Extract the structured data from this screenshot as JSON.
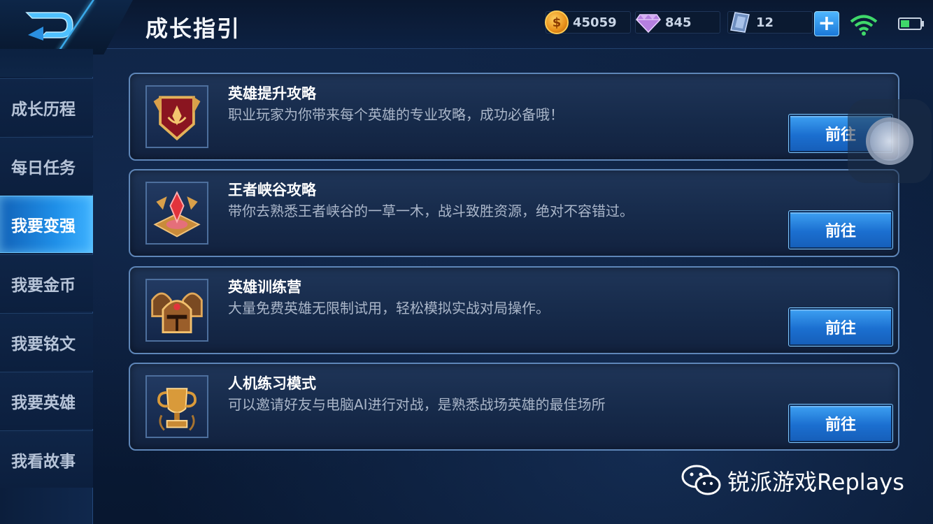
{
  "header": {
    "title": "成长指引",
    "currencies": {
      "gold": "45059",
      "gems": "845",
      "tickets": "12"
    },
    "plus_label": "+"
  },
  "sidebar": {
    "items": [
      {
        "label": "成长历程"
      },
      {
        "label": "每日任务"
      },
      {
        "label": "我要变强"
      },
      {
        "label": "我要金币"
      },
      {
        "label": "我要铭文"
      },
      {
        "label": "我要英雄"
      },
      {
        "label": "我看故事"
      }
    ],
    "active_index": 2
  },
  "cards": [
    {
      "title": "英雄提升攻略",
      "desc": "职业玩家为你带来每个英雄的专业攻略，成功必备哦！",
      "button": "前往",
      "icon": "crest-icon"
    },
    {
      "title": "王者峡谷攻略",
      "desc": "带你去熟悉王者峡谷的一草一木，战斗致胜资源，绝对不容错过。",
      "button": "前往",
      "icon": "crystal-icon"
    },
    {
      "title": "英雄训练营",
      "desc": "大量免费英雄无限制试用，轻松模拟实战对局操作。",
      "button": "前往",
      "icon": "helmet-icon"
    },
    {
      "title": "人机练习模式",
      "desc": "可以邀请好友与电脑AI进行对战，是熟悉战场英雄的最佳场所",
      "button": "前往",
      "icon": "trophy-icon"
    }
  ],
  "watermark": "锐派游戏Replays",
  "colors": {
    "accent": "#1f8fe8",
    "button": "#1b6fd0",
    "card_border": "#5e86b8"
  }
}
